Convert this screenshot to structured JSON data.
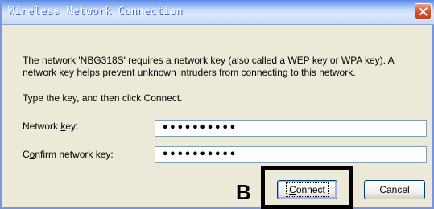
{
  "window": {
    "title": "Wireless Network Connection",
    "close_icon": "close-icon"
  },
  "message": {
    "line1": "The network 'NBG318S' requires a network key (also called a WEP key or WPA key). A",
    "line2": "network key helps prevent unknown intruders from connecting to this network."
  },
  "instruction": "Type the key, and then click Connect.",
  "fields": {
    "network_key": {
      "label_pre": "Network ",
      "label_accel": "k",
      "label_post": "ey:",
      "value": "••••••••••"
    },
    "confirm_key": {
      "label_pre": "C",
      "label_accel": "o",
      "label_post": "nfirm network key:",
      "value": "••••••••••"
    }
  },
  "buttons": {
    "connect_accel": "C",
    "connect_rest": "onnect",
    "cancel": "Cancel"
  },
  "annotation": {
    "callout": "B"
  },
  "colors": {
    "dialog_bg": "#ece9d8",
    "title_gradient_top": "#5d88e8",
    "close_red": "#d8512e",
    "field_border": "#7f9db9",
    "button_border": "#003c74"
  }
}
